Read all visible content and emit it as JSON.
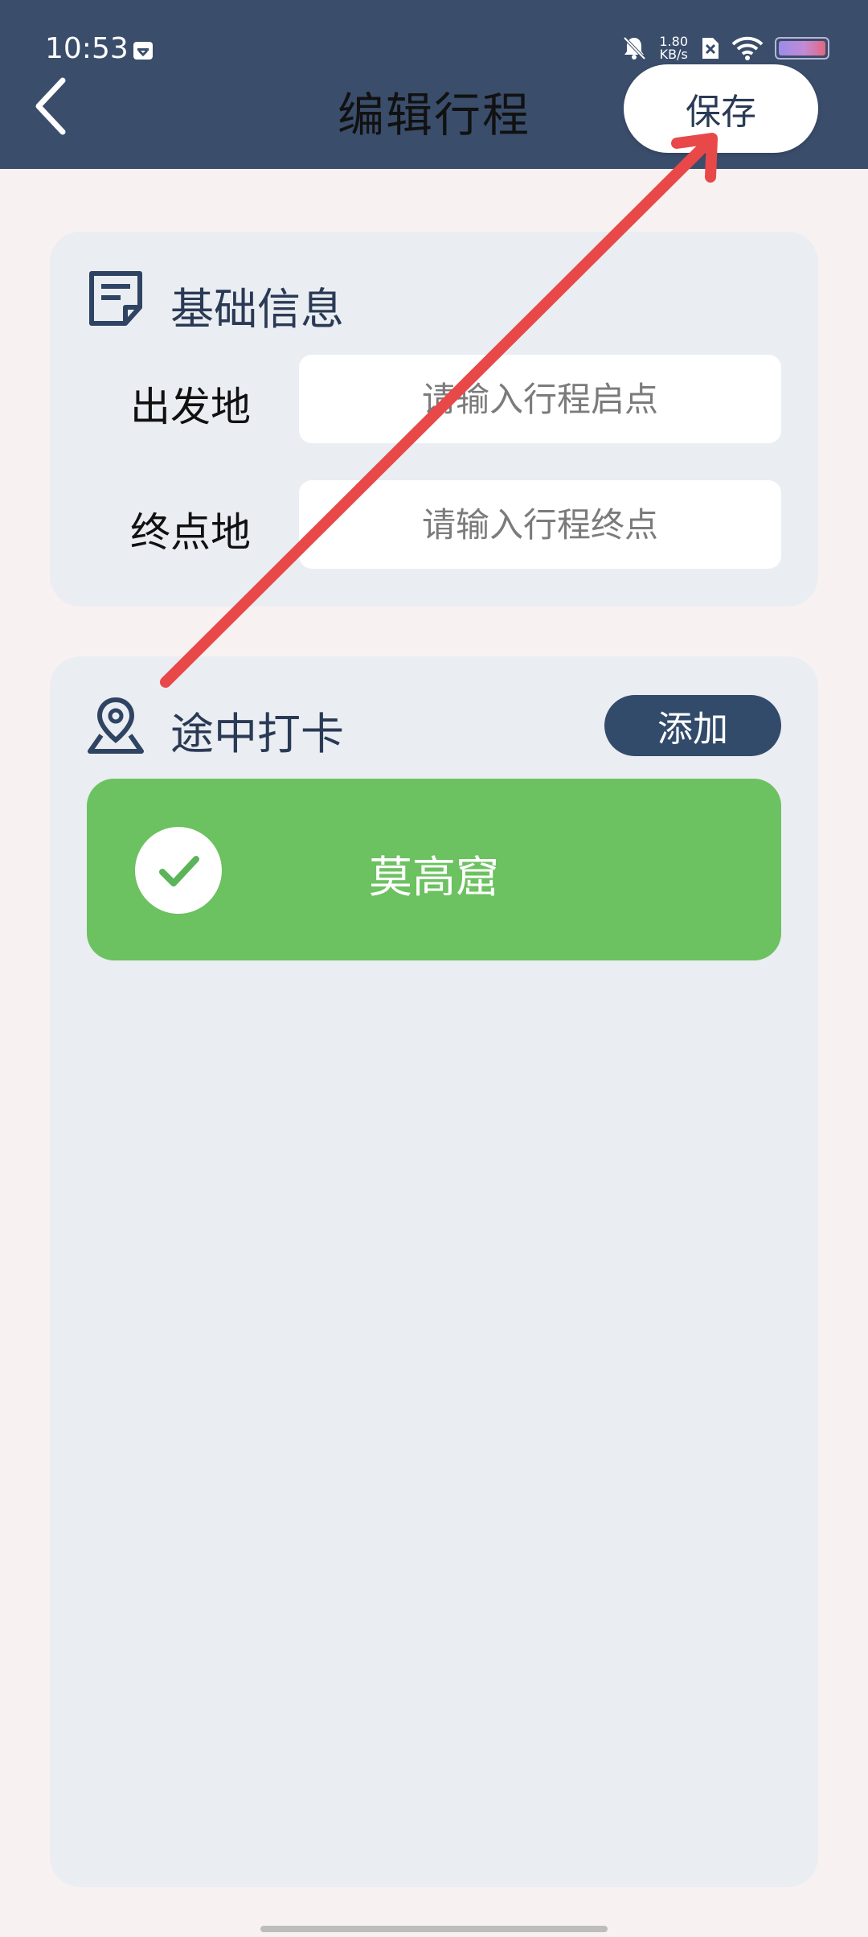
{
  "status_bar": {
    "time": "10:53",
    "net_speed_value": "1.80",
    "net_speed_unit": "KB/s"
  },
  "header": {
    "title": "编辑行程",
    "save_label": "保存"
  },
  "basic_info": {
    "title": "基础信息",
    "fields": [
      {
        "label": "出发地",
        "placeholder": "请输入行程启点",
        "value": ""
      },
      {
        "label": "终点地",
        "placeholder": "请输入行程终点",
        "value": ""
      }
    ]
  },
  "checkin": {
    "title": "途中打卡",
    "add_label": "添加",
    "items": [
      {
        "name": "莫高窟",
        "checked": true
      }
    ]
  },
  "colors": {
    "header_bg": "#3a4d6b",
    "accent_green": "#6cc160",
    "annotation_arrow": "#e84848"
  },
  "icons": [
    "back-chevron-icon",
    "note-icon",
    "map-pin-icon",
    "checkmark-icon",
    "bell-muted-icon",
    "wifi-icon",
    "battery-icon"
  ]
}
